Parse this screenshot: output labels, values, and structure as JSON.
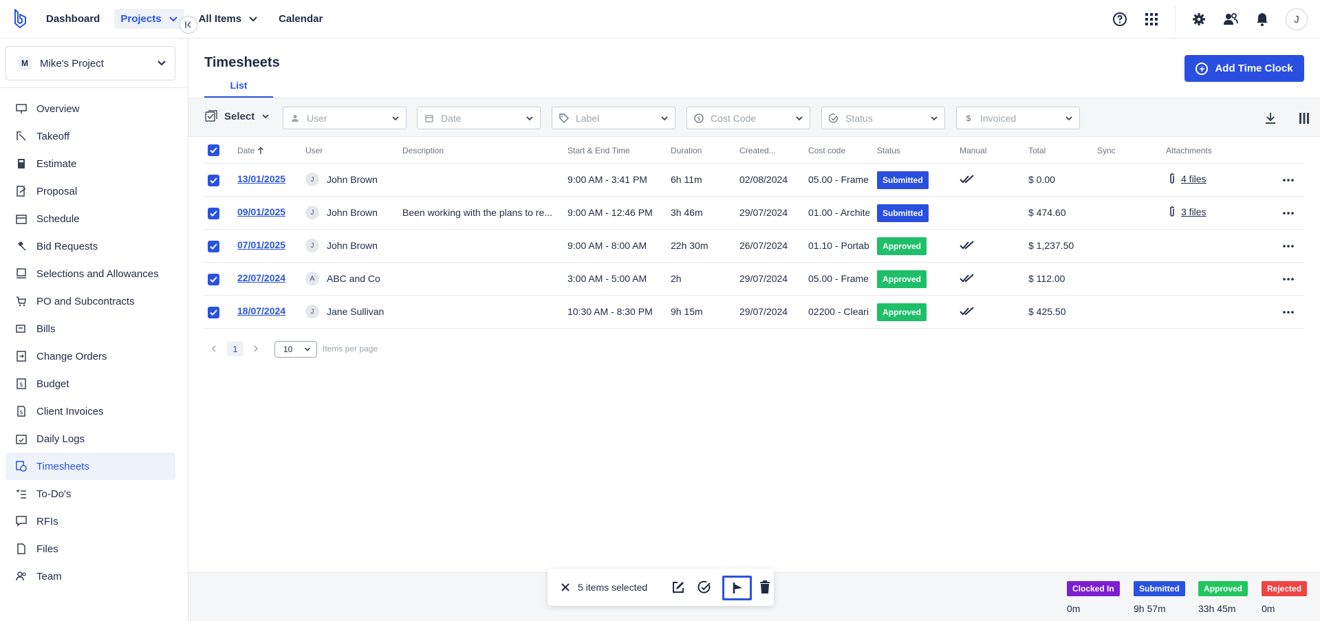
{
  "topnav": {
    "items": [
      {
        "label": "Dashboard"
      },
      {
        "label": "Projects"
      },
      {
        "label": "All Items"
      },
      {
        "label": "Calendar"
      }
    ],
    "avatar_initial": "J",
    "icons": [
      "help-icon",
      "apps-grid-icon",
      "gear-icon",
      "team-icon",
      "bell-icon"
    ]
  },
  "sidebar": {
    "project_badge": "M",
    "project_name": "Mike's Project",
    "items": [
      {
        "label": "Overview",
        "icon": "overview-icon"
      },
      {
        "label": "Takeoff",
        "icon": "takeoff-icon"
      },
      {
        "label": "Estimate",
        "icon": "calculator-icon"
      },
      {
        "label": "Proposal",
        "icon": "proposal-icon"
      },
      {
        "label": "Schedule",
        "icon": "calendar-icon"
      },
      {
        "label": "Bid Requests",
        "icon": "gavel-icon"
      },
      {
        "label": "Selections and Allowances",
        "icon": "selections-icon"
      },
      {
        "label": "PO and Subcontracts",
        "icon": "cart-icon"
      },
      {
        "label": "Bills",
        "icon": "bills-icon"
      },
      {
        "label": "Change Orders",
        "icon": "change-order-icon"
      },
      {
        "label": "Budget",
        "icon": "budget-icon"
      },
      {
        "label": "Client Invoices",
        "icon": "invoice-icon"
      },
      {
        "label": "Daily Logs",
        "icon": "daily-log-icon"
      },
      {
        "label": "Timesheets",
        "icon": "timesheet-icon"
      },
      {
        "label": "To-Do's",
        "icon": "todo-icon"
      },
      {
        "label": "RFIs",
        "icon": "rfi-icon"
      },
      {
        "label": "Files",
        "icon": "file-icon"
      },
      {
        "label": "Team",
        "icon": "team-icon"
      }
    ],
    "active_index": 13
  },
  "page": {
    "title": "Timesheets",
    "tab": "List",
    "add_button": "Add Time Clock"
  },
  "filters": {
    "select_label": "Select",
    "user": "User",
    "date": "Date",
    "label": "Label",
    "cost_code": "Cost Code",
    "status": "Status",
    "invoiced": "Invoiced"
  },
  "table": {
    "headers": {
      "date": "Date",
      "user": "User",
      "description": "Description",
      "time": "Start & End Time",
      "duration": "Duration",
      "created": "Created...",
      "cost_code": "Cost code",
      "status": "Status",
      "manual": "Manual",
      "total": "Total",
      "sync": "Sync",
      "attachments": "Attachments"
    },
    "rows": [
      {
        "date": "13/01/2025",
        "user_initial": "J",
        "user": "John Brown",
        "description": "",
        "time": "9:00 AM - 3:41 PM",
        "duration": "6h 11m",
        "created": "02/08/2024",
        "cost_code": "05.00 - Frame",
        "status": "Submitted",
        "manual": true,
        "total": "$ 0.00",
        "attachments": "4 files"
      },
      {
        "date": "09/01/2025",
        "user_initial": "J",
        "user": "John Brown",
        "description": "Been working with the plans to re...",
        "time": "9:00 AM - 12:46 PM",
        "duration": "3h 46m",
        "created": "29/07/2024",
        "cost_code": "01.00 - Archite",
        "status": "Submitted",
        "manual": false,
        "total": "$ 474.60",
        "attachments": "3 files"
      },
      {
        "date": "07/01/2025",
        "user_initial": "J",
        "user": "John Brown",
        "description": "",
        "time": "9:00 AM - 8:00 AM",
        "duration": "22h 30m",
        "created": "26/07/2024",
        "cost_code": "01.10 - Portab",
        "status": "Approved",
        "manual": true,
        "total": "$ 1,237.50",
        "attachments": ""
      },
      {
        "date": "22/07/2024",
        "user_initial": "A",
        "user": "ABC and Co",
        "description": "",
        "time": "3:00 AM - 5:00 AM",
        "duration": "2h",
        "created": "29/07/2024",
        "cost_code": "05.00 - Frame",
        "status": "Approved",
        "manual": true,
        "total": "$ 112.00",
        "attachments": ""
      },
      {
        "date": "18/07/2024",
        "user_initial": "J",
        "user": "Jane Sullivan",
        "description": "",
        "time": "10:30 AM - 8:30 PM",
        "duration": "9h 15m",
        "created": "29/07/2024",
        "cost_code": "02200 - Clearin",
        "status": "Approved",
        "manual": true,
        "total": "$ 425.50",
        "attachments": ""
      }
    ]
  },
  "pagination": {
    "page": "1",
    "per_page": "10",
    "per_page_label": "Items per page"
  },
  "selection": {
    "text": "5 items selected"
  },
  "legend": [
    {
      "label": "Clocked In",
      "value": "0m",
      "color": "#7c1fd1"
    },
    {
      "label": "Submitted",
      "value": "9h 57m",
      "color": "#2952e3"
    },
    {
      "label": "Approved",
      "value": "33h 45m",
      "color": "#22c55e"
    },
    {
      "label": "Rejected",
      "value": "0m",
      "color": "#ef4444"
    }
  ],
  "colors": {
    "accent": "#2952e3",
    "submitted": "#2a4fe0",
    "approved": "#1fbf6a"
  }
}
